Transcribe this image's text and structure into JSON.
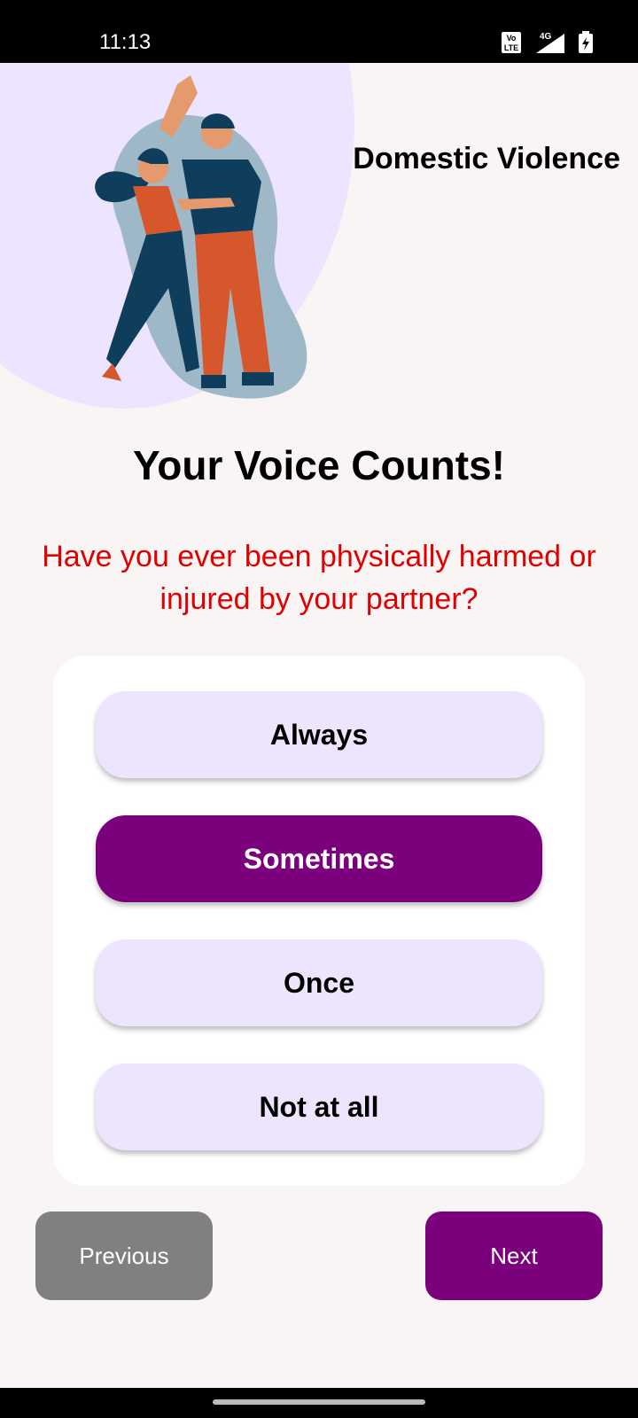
{
  "status_bar": {
    "time": "11:13",
    "icons": [
      "volte-icon",
      "4g-signal-icon",
      "battery-charging-icon"
    ],
    "network": "4G"
  },
  "header": {
    "title": "Domestic Violence"
  },
  "main": {
    "heading": "Your Voice Counts!",
    "question": "Have you ever been physically harmed or injured by your partner?",
    "options": [
      {
        "label": "Always",
        "selected": false
      },
      {
        "label": "Sometimes",
        "selected": true
      },
      {
        "label": "Once",
        "selected": false
      },
      {
        "label": "Not at all",
        "selected": false
      }
    ]
  },
  "navigation": {
    "previous_label": "Previous",
    "next_label": "Next"
  },
  "colors": {
    "accent": "#7b007b",
    "question": "#e00000",
    "option_bg": "#ede5fd",
    "previous_bg": "#808080"
  }
}
